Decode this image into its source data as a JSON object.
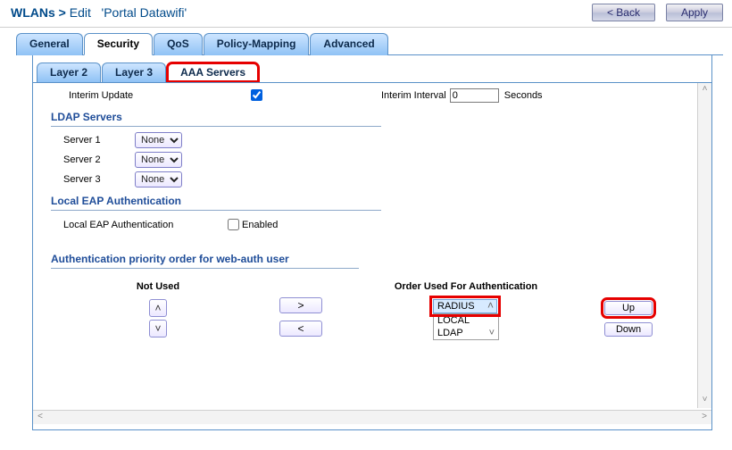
{
  "header": {
    "breadcrumb1": "WLANs",
    "breadcrumb2": "Edit",
    "name": "'Portal Datawifi'",
    "back_label": "< Back",
    "apply_label": "Apply"
  },
  "tabs": {
    "general": "General",
    "security": "Security",
    "qos": "QoS",
    "policy": "Policy-Mapping",
    "advanced": "Advanced"
  },
  "subtabs": {
    "layer2": "Layer 2",
    "layer3": "Layer 3",
    "aaa": "AAA Servers"
  },
  "interim": {
    "update_label": "Interim Update",
    "interval_label": "Interim Interval",
    "value": "0",
    "unit": "Seconds"
  },
  "ldap": {
    "heading": "LDAP Servers",
    "row1": "Server 1",
    "row2": "Server 2",
    "row3": "Server 3",
    "none": "None"
  },
  "localeap": {
    "heading": "Local EAP Authentication",
    "label": "Local EAP Authentication",
    "enabled": "Enabled"
  },
  "priority": {
    "heading": "Authentication priority order for web-auth user",
    "not_used": "Not Used",
    "order_used": "Order Used For Authentication",
    "move_right": ">",
    "move_left": "<",
    "radius": "RADIUS",
    "local": "LOCAL",
    "ldap": "LDAP",
    "up": "Up",
    "down": "Down"
  }
}
